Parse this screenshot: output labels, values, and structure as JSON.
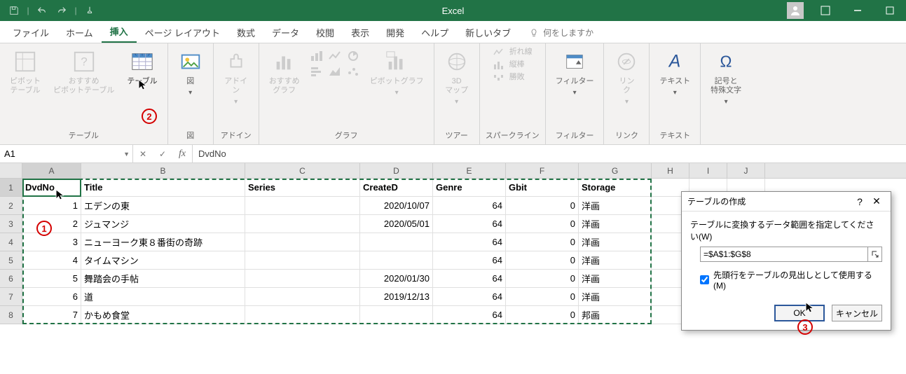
{
  "title": "Excel",
  "tabs": [
    "ファイル",
    "ホーム",
    "挿入",
    "ページ レイアウト",
    "数式",
    "データ",
    "校閲",
    "表示",
    "開発",
    "ヘルプ",
    "新しいタブ"
  ],
  "active_tab": 2,
  "tell_me": "何をしますか",
  "ribbon": {
    "g_tables": {
      "cap": "テーブル",
      "pivot": "ピボット\nテーブル",
      "recpivot": "おすすめ\nピボットテーブル",
      "table": "テーブル"
    },
    "g_illust": {
      "cap": "図",
      "pict": "図"
    },
    "g_addin": {
      "cap": "アドイン",
      "addin": "アドイ\nン"
    },
    "g_chart": {
      "cap": "グラフ",
      "rec": "おすすめ\nグラフ",
      "pivch": "ピボットグラフ"
    },
    "g_tour": {
      "cap": "ツアー",
      "map": "3D\nマップ"
    },
    "g_spark": {
      "cap": "スパークライン",
      "line": "折れ線",
      "col": "縦棒",
      "wl": "勝敗"
    },
    "g_filter": {
      "cap": "フィルター",
      "flt": "フィルター"
    },
    "g_link": {
      "cap": "リンク",
      "lnk": "リン\nク"
    },
    "g_text": {
      "cap": "テキスト",
      "txt": "テキスト"
    },
    "g_sym": {
      "cap": "記号と\n特殊文字",
      "sym": "記号と\n特殊文字"
    }
  },
  "namebox": "A1",
  "formula": "DvdNo",
  "columns": [
    "A",
    "B",
    "C",
    "D",
    "E",
    "F",
    "G",
    "H",
    "I",
    "J"
  ],
  "headers": {
    "A": "DvdNo",
    "B": "Title",
    "C": "Series",
    "D": "CreateD",
    "E": "Genre",
    "F": "Gbit",
    "G": "Storage"
  },
  "rows": [
    {
      "n": "1",
      "A": "1",
      "B": "エデンの東",
      "C": "",
      "D": "2020/10/07",
      "E": "64",
      "F": "0",
      "G": "洋画"
    },
    {
      "n": "2",
      "A": "2",
      "B": "ジュマンジ",
      "C": "",
      "D": "2020/05/01",
      "E": "64",
      "F": "0",
      "G": "洋画"
    },
    {
      "n": "3",
      "A": "3",
      "B": "ニューヨーク東８番街の奇跡",
      "C": "",
      "D": "",
      "E": "64",
      "F": "0",
      "G": "洋画"
    },
    {
      "n": "4",
      "A": "4",
      "B": "タイムマシン",
      "C": "",
      "D": "",
      "E": "64",
      "F": "0",
      "G": "洋画"
    },
    {
      "n": "5",
      "A": "5",
      "B": "舞踏会の手帖",
      "C": "",
      "D": "2020/01/30",
      "E": "64",
      "F": "0",
      "G": "洋画"
    },
    {
      "n": "6",
      "A": "6",
      "B": "道",
      "C": "",
      "D": "2019/12/13",
      "E": "64",
      "F": "0",
      "G": "洋画"
    },
    {
      "n": "7",
      "A": "7",
      "B": "かもめ食堂",
      "C": "",
      "D": "",
      "E": "64",
      "F": "0",
      "G": "邦画"
    }
  ],
  "dialog": {
    "title": "テーブルの作成",
    "msg": "テーブルに変換するデータ範囲を指定してください(W)",
    "range": "=$A$1:$G$8",
    "chk": "先頭行をテーブルの見出しとして使用する(M)",
    "ok": "OK",
    "cancel": "キャンセル"
  },
  "annot": {
    "a1": "1",
    "a2": "2",
    "a3": "3"
  }
}
